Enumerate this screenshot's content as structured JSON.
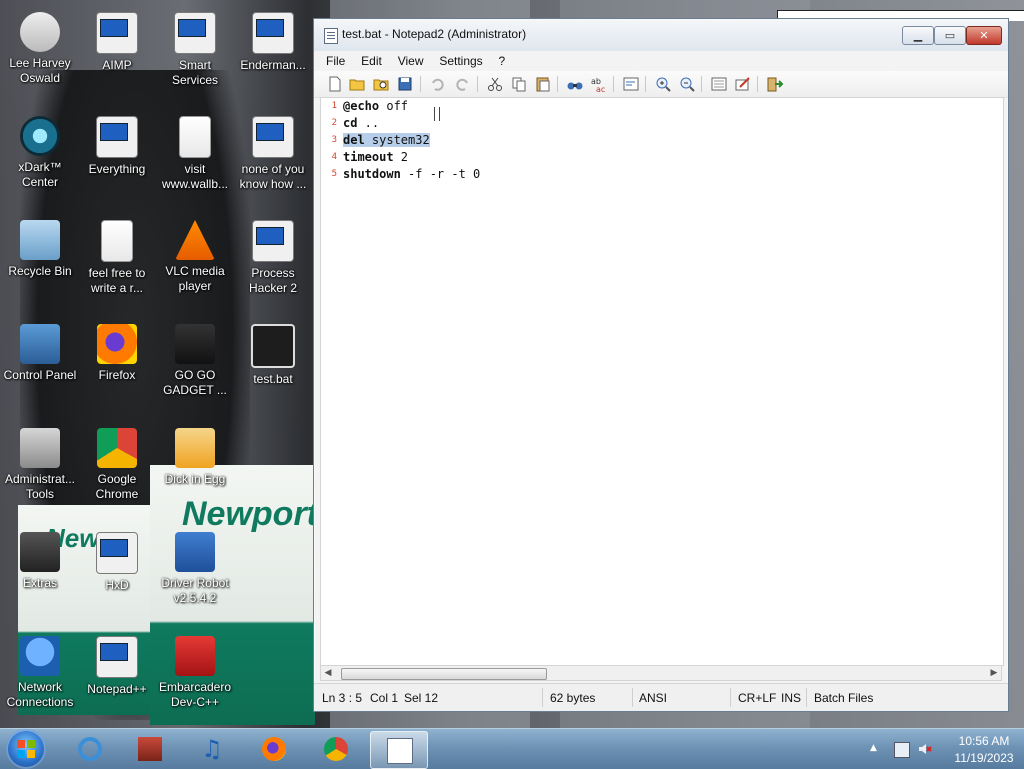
{
  "desktop": {
    "icons": [
      {
        "label": "Lee Harvey\nOswald",
        "icon": "person-icon"
      },
      {
        "label": "AIMP",
        "icon": "app-icon"
      },
      {
        "label": "Smart\nServices",
        "icon": "app-icon"
      },
      {
        "label": "Enderman...",
        "icon": "app-icon"
      },
      {
        "label": "xDark™\nCenter",
        "icon": "app-icon"
      },
      {
        "label": "Everything",
        "icon": "app-icon"
      },
      {
        "label": "visit\nwww.wallb...",
        "icon": "document-icon"
      },
      {
        "label": "none of you\nknow how ...",
        "icon": "app-icon"
      },
      {
        "label": "Recycle Bin",
        "icon": "recycle-bin-icon"
      },
      {
        "label": "feel free to\nwrite a r...",
        "icon": "document-icon"
      },
      {
        "label": "VLC media\nplayer",
        "icon": "vlc-icon"
      },
      {
        "label": "Process\nHacker 2",
        "icon": "app-icon"
      },
      {
        "label": "Control Panel",
        "icon": "control-panel-icon"
      },
      {
        "label": "Firefox",
        "icon": "firefox-icon"
      },
      {
        "label": "GO GO\nGADGET ...",
        "icon": "app-icon"
      },
      {
        "label": "test.bat",
        "icon": "batch-file-icon"
      },
      {
        "label": "Administrat...\nTools",
        "icon": "tools-icon"
      },
      {
        "label": "Google\nChrome",
        "icon": "chrome-icon"
      },
      {
        "label": "Dick in Egg",
        "icon": "app-icon"
      },
      {
        "label": "Extras",
        "icon": "app-icon"
      },
      {
        "label": "HxD",
        "icon": "app-icon"
      },
      {
        "label": "Driver Robot\nv2.5.4.2",
        "icon": "app-icon"
      },
      {
        "label": "Network\nConnections",
        "icon": "network-icon"
      },
      {
        "label": "Notepad++",
        "icon": "app-icon"
      },
      {
        "label": "Embarcadero\nDev-C++",
        "icon": "app-icon"
      }
    ],
    "wallpaper_text": "Newport"
  },
  "window": {
    "title": "test.bat - Notepad2 (Administrator)",
    "menu": [
      "File",
      "Edit",
      "View",
      "Settings",
      "?"
    ],
    "editor": {
      "lines": [
        {
          "num": "1",
          "kw": "@echo",
          "rest": " off"
        },
        {
          "num": "2",
          "kw": "cd",
          "rest": " .."
        },
        {
          "num": "3",
          "kw": "del",
          "rest": " system32",
          "selected": true
        },
        {
          "num": "4",
          "kw": "timeout",
          "rest": " 2"
        },
        {
          "num": "5",
          "kw": "shutdown",
          "rest": " -f -r -t 0"
        }
      ]
    },
    "status": {
      "position": "Ln 3 : 5",
      "col": "Col 1",
      "sel": "Sel 12",
      "size": "62 bytes",
      "encoding": "ANSI",
      "eol": "CR+LF",
      "mode": "INS",
      "lexer": "Batch Files"
    }
  },
  "taskbar": {
    "time": "10:56 AM",
    "date": "11/19/2023"
  },
  "colors": {
    "selection": "#b6cee9",
    "line_number": "#d4442e",
    "taskbar": "#6e93b5"
  }
}
